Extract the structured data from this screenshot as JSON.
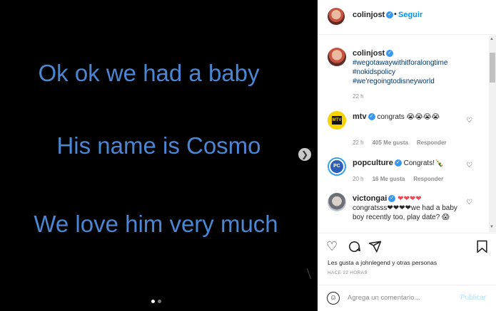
{
  "media": {
    "lines": [
      "Ok ok we had a baby",
      "His name is Cosmo",
      "We love him very much"
    ],
    "next_icon": "chevron-right-icon",
    "colors": {
      "background": "#000000",
      "text": "#4a86d4"
    }
  },
  "header": {
    "username": "colinjost",
    "separator": "•",
    "follow_label": "Seguir"
  },
  "caption": {
    "username": "colinjost",
    "hashtags": [
      "#wegotawaywithitforalongtime",
      "#nokidspolicy",
      "#we'regoingtodisneyworld"
    ],
    "time": "22 h"
  },
  "comments": [
    {
      "username": "mtv",
      "text": "congrats 😭😭😭😭",
      "time": "22 h",
      "likes": "405 Me gusta",
      "reply": "Responder"
    },
    {
      "username": "popculture",
      "text": "Congrats!🍾",
      "time": "20 h",
      "likes": "16 Me gusta",
      "reply": "Responder"
    },
    {
      "username": "victongai",
      "hearts": "❤❤❤❤",
      "text": "congratsss❤❤❤❤we had a baby boy recently too, play date? 😱"
    }
  ],
  "actions": {
    "likes_text": "Les gusta a johnlegend y otras personas",
    "time_ago": "HACE 22 HORAS",
    "comment_placeholder": "Agrega un comentario...",
    "publish_label": "Publicar"
  },
  "watermark": "\\",
  "colors": {
    "accent": "#0095f6",
    "verified": "#3897f0",
    "heart": "#ed4956"
  }
}
